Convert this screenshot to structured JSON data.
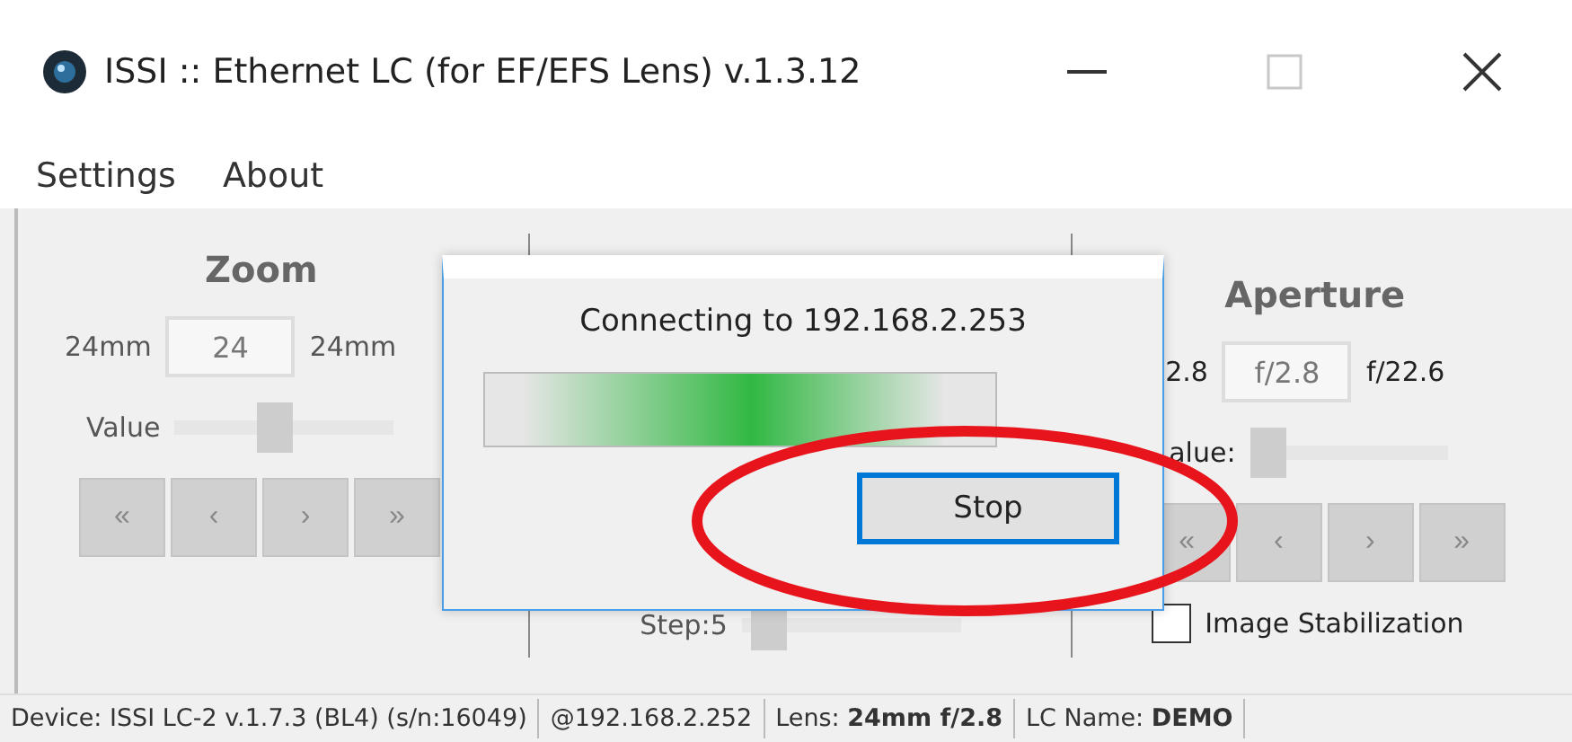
{
  "window": {
    "title": "ISSI :: Ethernet LC (for EF/EFS Lens) v.1.3.12",
    "controls": [
      {
        "kind": "minimize",
        "disabled": false
      },
      {
        "kind": "maximize",
        "disabled": true
      },
      {
        "kind": "close",
        "disabled": false
      }
    ]
  },
  "menu": [
    "Settings",
    "About"
  ],
  "zoom": {
    "title": "Zoom",
    "min": "24mm",
    "value": "24",
    "max": "24mm",
    "slider_label": "Value",
    "level": 0.45,
    "buttons": [
      "«",
      "‹",
      "›",
      "»"
    ]
  },
  "middle": {
    "step_label": "Step:5",
    "level": 0.05
  },
  "aperture": {
    "title": "Aperture",
    "min": "2.8",
    "value": "f/2.8",
    "max": "f/22.6",
    "slider_label": "alue:",
    "level": 0,
    "buttons": [
      "«",
      "‹",
      "›",
      "»"
    ],
    "stabilization": {
      "label": "Image Stabilization",
      "checked": false
    }
  },
  "dialog": {
    "message": "Connecting to 192.168.2.253",
    "progress": {
      "level": 0.9
    },
    "button": "Stop",
    "focused": true
  },
  "status_bar": [
    "Device: ISSI LC-2 v.1.7.3 (BL4) (s/n:16049)",
    "@192.168.2.252",
    "Lens: **24mm f/2.8**",
    "LC Name: **DEMO**"
  ]
}
